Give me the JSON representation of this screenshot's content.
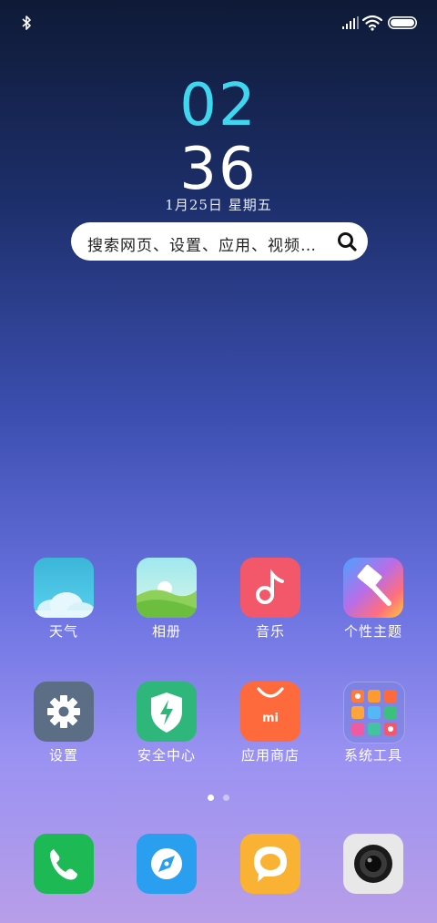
{
  "clock": {
    "hour": "02",
    "minute": "36",
    "date": "1月25日 星期五"
  },
  "search": {
    "placeholder": "搜索网页、设置、应用、视频…"
  },
  "apps": [
    {
      "label": "天气",
      "icon": "weather-icon"
    },
    {
      "label": "相册",
      "icon": "gallery-icon"
    },
    {
      "label": "音乐",
      "icon": "music-icon"
    },
    {
      "label": "个性主题",
      "icon": "themes-icon"
    },
    {
      "label": "设置",
      "icon": "gear-icon"
    },
    {
      "label": "安全中心",
      "icon": "shield-icon"
    },
    {
      "label": "应用商店",
      "icon": "shopping-bag-icon"
    },
    {
      "label": "系统工具",
      "icon": "folder-icon"
    }
  ],
  "dock": [
    {
      "icon": "phone-icon"
    },
    {
      "icon": "browser-icon"
    },
    {
      "icon": "message-icon"
    },
    {
      "icon": "camera-icon"
    }
  ],
  "pages": {
    "current": 1,
    "total": 2
  },
  "colors": {
    "hour": "#3fd6f0",
    "phone": "#1db954",
    "browser": "#2a9ff0",
    "message": "#f9b233",
    "camera": "#e8e8e8",
    "music": "#f2586a",
    "settings": "#5b6e86",
    "security": "#2fb67a",
    "store": "#ff6a3d"
  }
}
